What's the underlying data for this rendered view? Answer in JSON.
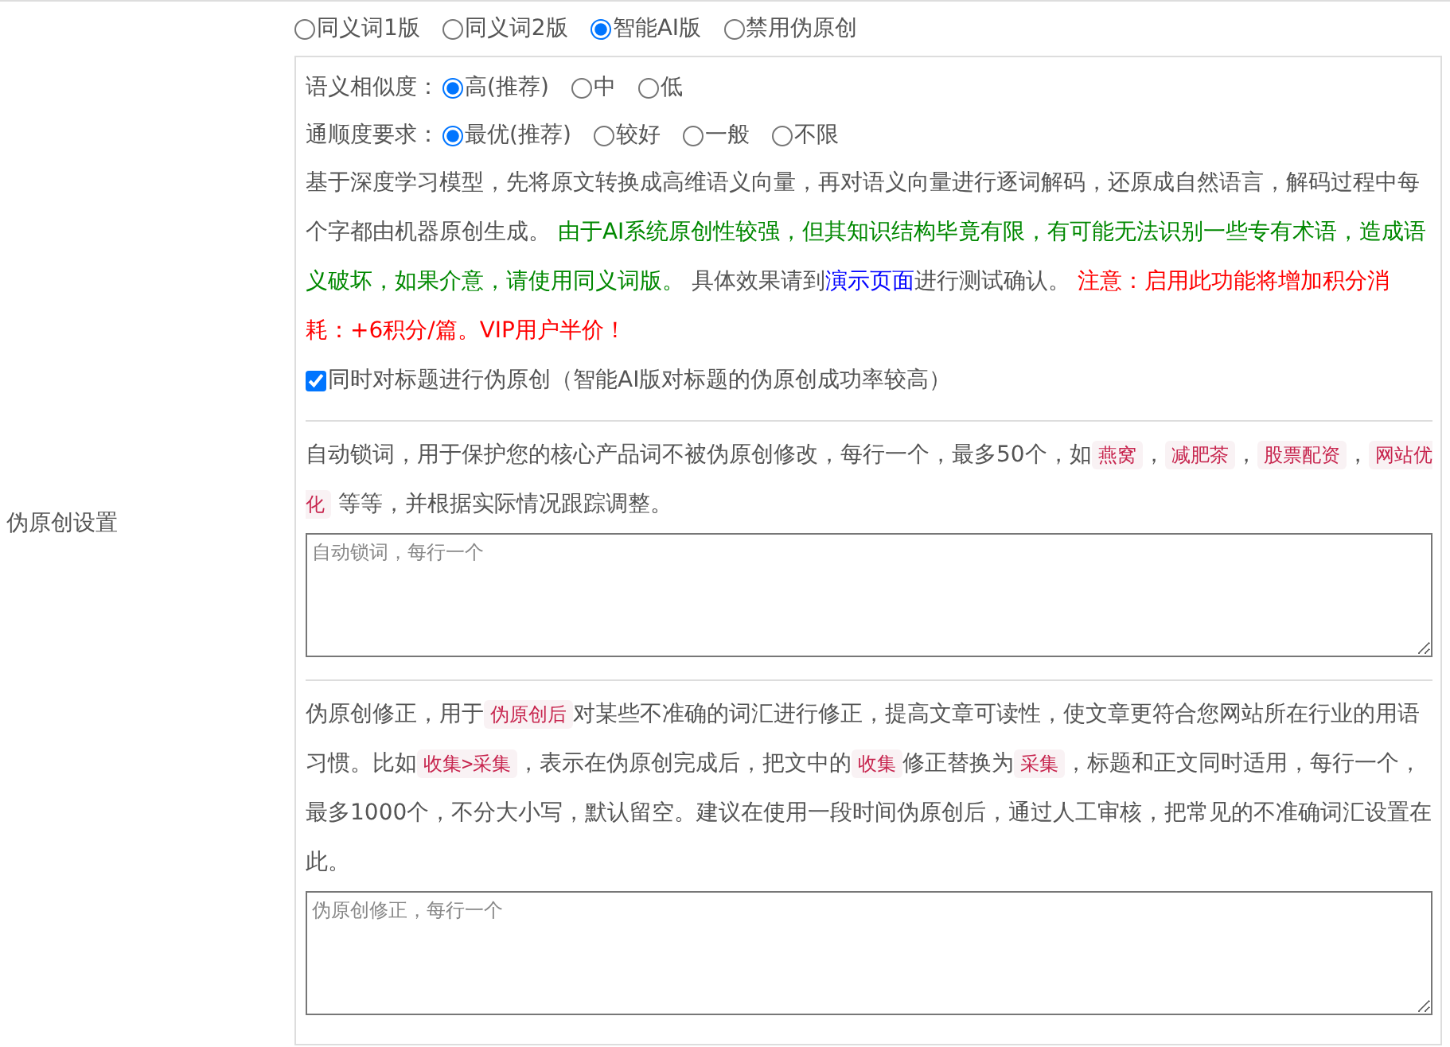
{
  "settings_label": "伪原创设置",
  "modes": [
    {
      "label": "同义词1版",
      "selected": false
    },
    {
      "label": "同义词2版",
      "selected": false
    },
    {
      "label": "智能AI版",
      "selected": true
    },
    {
      "label": "禁用伪原创",
      "selected": false
    }
  ],
  "similarity": {
    "label": "语义相似度：",
    "options": [
      {
        "label": "高(推荐)",
        "selected": true
      },
      {
        "label": "中",
        "selected": false
      },
      {
        "label": "低",
        "selected": false
      }
    ]
  },
  "fluency": {
    "label": "通顺度要求：",
    "options": [
      {
        "label": "最优(推荐)",
        "selected": true
      },
      {
        "label": "较好",
        "selected": false
      },
      {
        "label": "一般",
        "selected": false
      },
      {
        "label": "不限",
        "selected": false
      }
    ]
  },
  "ai_description": [
    {
      "kind": "plain",
      "text": "基于深度学习模型，先将原文转换成高维语义向量，再对语义向量进行逐词解码，还原成自然语言，解码过程中每个字都由机器原创生成。 "
    },
    {
      "kind": "green",
      "text": "由于AI系统原创性较强，但其知识结构毕竟有限，有可能无法识别一些专有术语，造成语义破坏，如果介意，请使用同义词版。"
    },
    {
      "kind": "plain",
      "text": " 具体效果请到"
    },
    {
      "kind": "link",
      "text": "演示页面"
    },
    {
      "kind": "plain",
      "text": "进行测试确认。 "
    },
    {
      "kind": "red",
      "text": "注意：启用此功能将增加积分消耗：+6积分/篇。VIP用户半价！"
    }
  ],
  "title_option": {
    "label": "同时对标题进行伪原创（智能AI版对标题的伪原创成功率较高）",
    "checked": true
  },
  "lock_words": {
    "description": [
      {
        "kind": "plain",
        "text": "自动锁词，用于保护您的核心产品词不被伪原创修改，每行一个，最多50个，如"
      },
      {
        "kind": "code",
        "text": "燕窝"
      },
      {
        "kind": "plain",
        "text": "，"
      },
      {
        "kind": "code",
        "text": "减肥茶"
      },
      {
        "kind": "plain",
        "text": "，"
      },
      {
        "kind": "code",
        "text": "股票配资"
      },
      {
        "kind": "plain",
        "text": "，"
      },
      {
        "kind": "code",
        "text": "网站优化"
      },
      {
        "kind": "plain",
        "text": " 等等，并根据实际情况跟踪调整。"
      }
    ],
    "placeholder": "自动锁词，每行一个"
  },
  "correction": {
    "description": [
      {
        "kind": "plain",
        "text": "伪原创修正，用于"
      },
      {
        "kind": "code",
        "text": "伪原创后"
      },
      {
        "kind": "plain",
        "text": "对某些不准确的词汇进行修正，提高文章可读性，使文章更符合您网站所在行业的用语习惯。比如"
      },
      {
        "kind": "code",
        "text": "收集>采集"
      },
      {
        "kind": "plain",
        "text": "，表示在伪原创完成后，把文中的"
      },
      {
        "kind": "code",
        "text": "收集"
      },
      {
        "kind": "plain",
        "text": "修正替换为"
      },
      {
        "kind": "code",
        "text": "采集"
      },
      {
        "kind": "plain",
        "text": "，标题和正文同时适用，每行一个，最多1000个，不分大小写，默认留空。建议在使用一段时间伪原创后，通过人工审核，把常见的不准确词汇设置在此。"
      }
    ],
    "placeholder": "伪原创修正，每行一个"
  }
}
